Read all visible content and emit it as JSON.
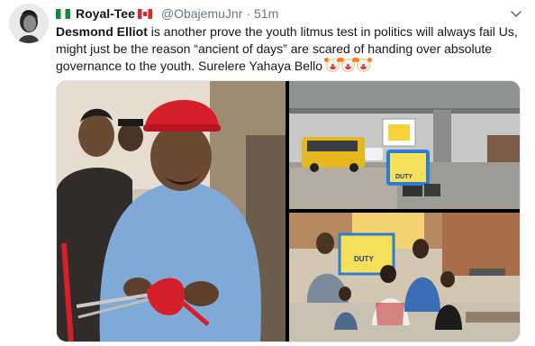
{
  "tweet": {
    "display_name": "Royal-Tee",
    "handle": "@ObajemuJnr",
    "separator": "·",
    "time": "51m",
    "mention": "Desmond Elliot",
    "body": " is another prove the youth litmus test in politics will always fail Us, might just be the reason “ancient of days” are scared of handing over absolute governance to the youth. Surelere Yahaya Bello ",
    "emoji_count": 3
  },
  "icons": {
    "avatar": "avatar",
    "flag_1": "nigeria-flag-icon",
    "flag_2": "canada-flag-icon",
    "menu": "chevron-down-icon",
    "emoji": "clown-face-icon"
  },
  "photo_2": {
    "sign_text": "DUTY"
  },
  "photo_3": {
    "sign_text": "DUTY"
  },
  "colors": {
    "text": "#14171a",
    "secondary": "#657786",
    "border": "#e1e8ed",
    "cap_red": "#d51f2a",
    "shirt_blue": "#7fa9d6"
  }
}
